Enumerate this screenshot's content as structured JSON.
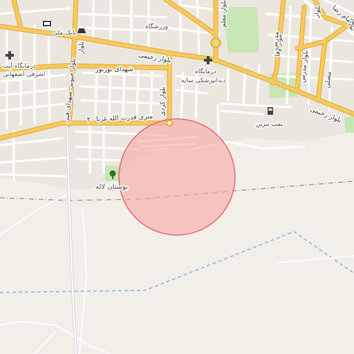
{
  "map": {
    "background": "#f2efe9",
    "colors": {
      "major_road": "#f7c95c",
      "major_road_casing": "#e0a83a",
      "minor_road": "#ffffff",
      "block": "#e4e0d8",
      "park": "#c8e6b4",
      "railway": "#9a8f8f",
      "boundary": "#8ab6e4",
      "radius_fill": "#f7a6a6",
      "radius_stroke": "#e5686d",
      "pin": "#f5a623"
    },
    "labels": {
      "bank": "بانک ملی",
      "gym": "ورزشگاه",
      "clinic_ashrafi_1": "درمانگاه آیت",
      "clinic_ashrafi_2": "اشرفی اصفهانی",
      "clinic_dental_1": "درمانگاه",
      "clinic_dental_2": "دندانپزشکی سایه",
      "road_rahimi_west": "بلوار رحیمی",
      "road_rahimi_east": "بلوار رحیمی",
      "road_shohada": "شهدای بوربور",
      "road_qodratollah": "۲۰ متری قدرت الله غربا",
      "road_kardi": "بلوار کردی",
      "road_jonoobi": "بلوار جنوبی شهدای فنی",
      "road_moallem": "بلوار معلم",
      "road_vafa": "بلوار وفا",
      "road_imamreza": "بلوار امام رضا",
      "road_modarres": "بلوار مدرس",
      "road_nw": "بلوار",
      "road_ne": "بلوار",
      "road_mosalla": "مصلی",
      "road_modarres2": "مدرس",
      "road_imam": "امام",
      "gas_station": "پمپ بنزین",
      "park_laleh": "بوستان لاله"
    },
    "icons": [
      "atm-icon",
      "bank-icon",
      "hospital-icon",
      "hospital-icon-2",
      "fuel-icon",
      "park-icon",
      "roundabout-icon",
      "location-pin-icon"
    ],
    "search_radius": {
      "shape": "circle"
    }
  }
}
